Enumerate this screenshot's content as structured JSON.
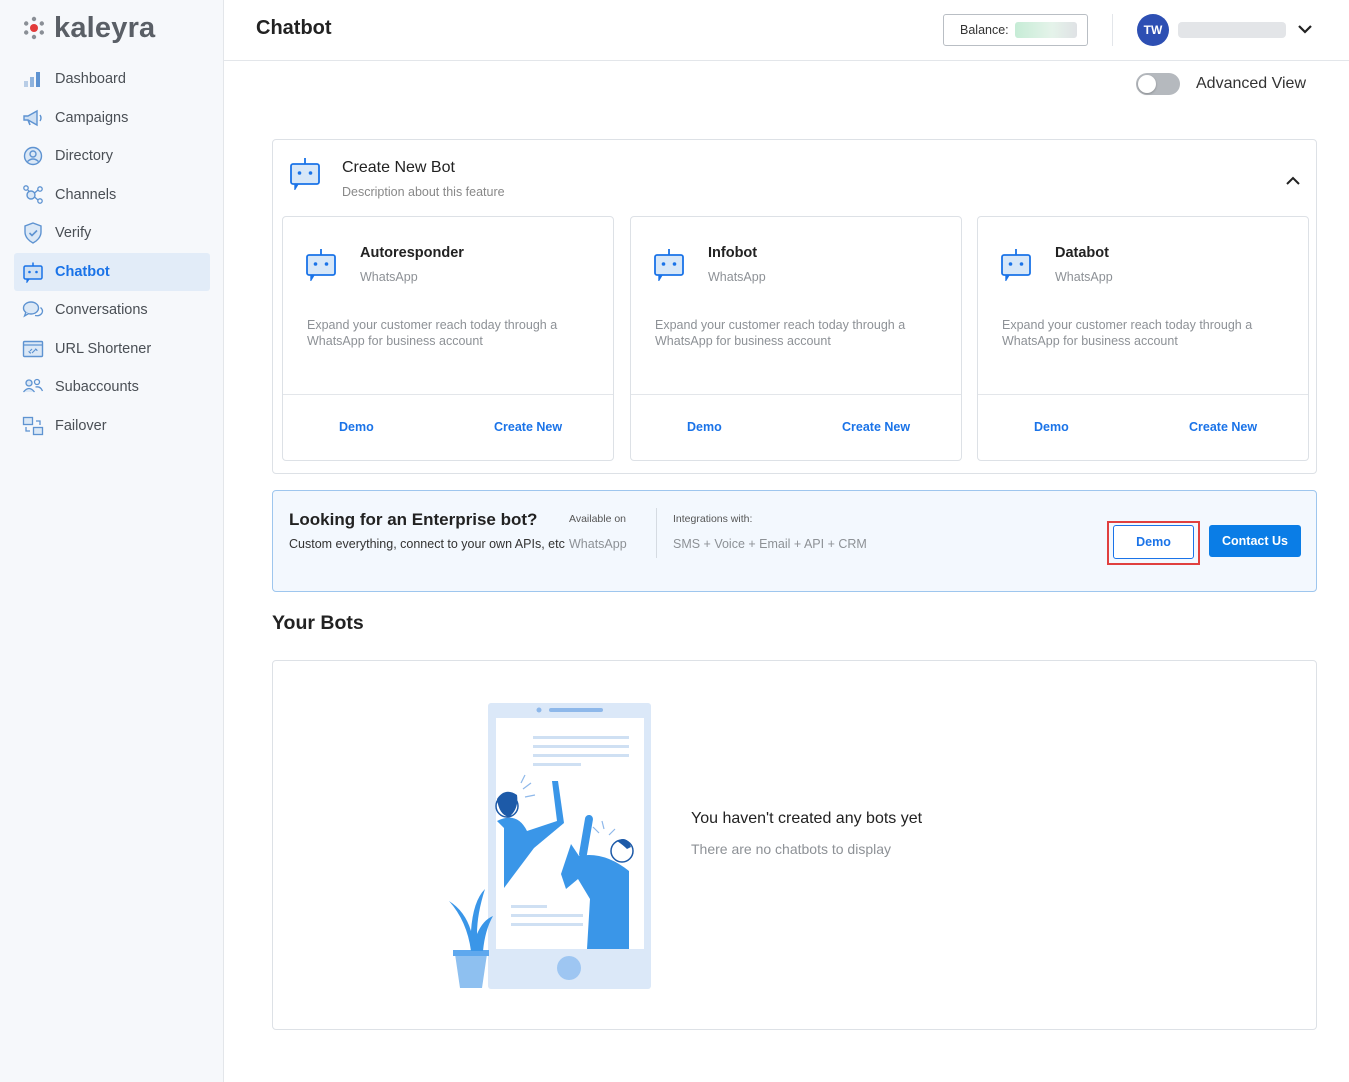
{
  "brand": {
    "name": "kaleyra"
  },
  "sidebar": {
    "items": [
      {
        "label": "Dashboard",
        "icon": "bar-chart-icon",
        "active": false
      },
      {
        "label": "Campaigns",
        "icon": "megaphone-icon",
        "active": false
      },
      {
        "label": "Directory",
        "icon": "user-circle-icon",
        "active": false
      },
      {
        "label": "Channels",
        "icon": "channels-icon",
        "active": false
      },
      {
        "label": "Verify",
        "icon": "shield-check-icon",
        "active": false
      },
      {
        "label": "Chatbot",
        "icon": "robot-icon",
        "active": true
      },
      {
        "label": "Conversations",
        "icon": "chat-bubbles-icon",
        "active": false
      },
      {
        "label": "URL Shortener",
        "icon": "link-icon",
        "active": false
      },
      {
        "label": "Subaccounts",
        "icon": "users-icon",
        "active": false
      },
      {
        "label": "Failover",
        "icon": "failover-icon",
        "active": false
      }
    ]
  },
  "header": {
    "title": "Chatbot",
    "balance_label": "Balance:",
    "avatar_initials": "TW"
  },
  "advanced_view": {
    "label": "Advanced View",
    "enabled": false
  },
  "create_panel": {
    "title": "Create New Bot",
    "description": "Description about this feature",
    "cards": [
      {
        "name": "Autoresponder",
        "channel": "WhatsApp",
        "description": "Expand your customer reach today through a WhatsApp for business account",
        "demo_label": "Demo",
        "create_label": "Create New"
      },
      {
        "name": "Infobot",
        "channel": "WhatsApp",
        "description": "Expand your customer reach today through a WhatsApp for business account",
        "demo_label": "Demo",
        "create_label": "Create New"
      },
      {
        "name": "Databot",
        "channel": "WhatsApp",
        "description": "Expand your customer reach today through a WhatsApp for business account",
        "demo_label": "Demo",
        "create_label": "Create New"
      }
    ]
  },
  "enterprise": {
    "title": "Looking for an Enterprise bot?",
    "subtitle": "Custom everything, connect to your own APIs, etc",
    "available_label": "Available on",
    "available_value": "WhatsApp",
    "integrations_label": "Integrations with:",
    "integrations_value": "SMS + Voice + Email + API + CRM",
    "demo_label": "Demo",
    "contact_label": "Contact Us"
  },
  "your_bots": {
    "title": "Your Bots",
    "empty_title": "You haven't created any bots yet",
    "empty_subtitle": "There are no chatbots to display"
  },
  "colors": {
    "accent": "#1a73e8",
    "primary_button": "#0a7de6",
    "sidebar_bg": "#f6f8fb",
    "active_nav_bg": "#e2ecf8",
    "highlight": "#e0403f",
    "avatar_bg": "#2d4fb3"
  }
}
